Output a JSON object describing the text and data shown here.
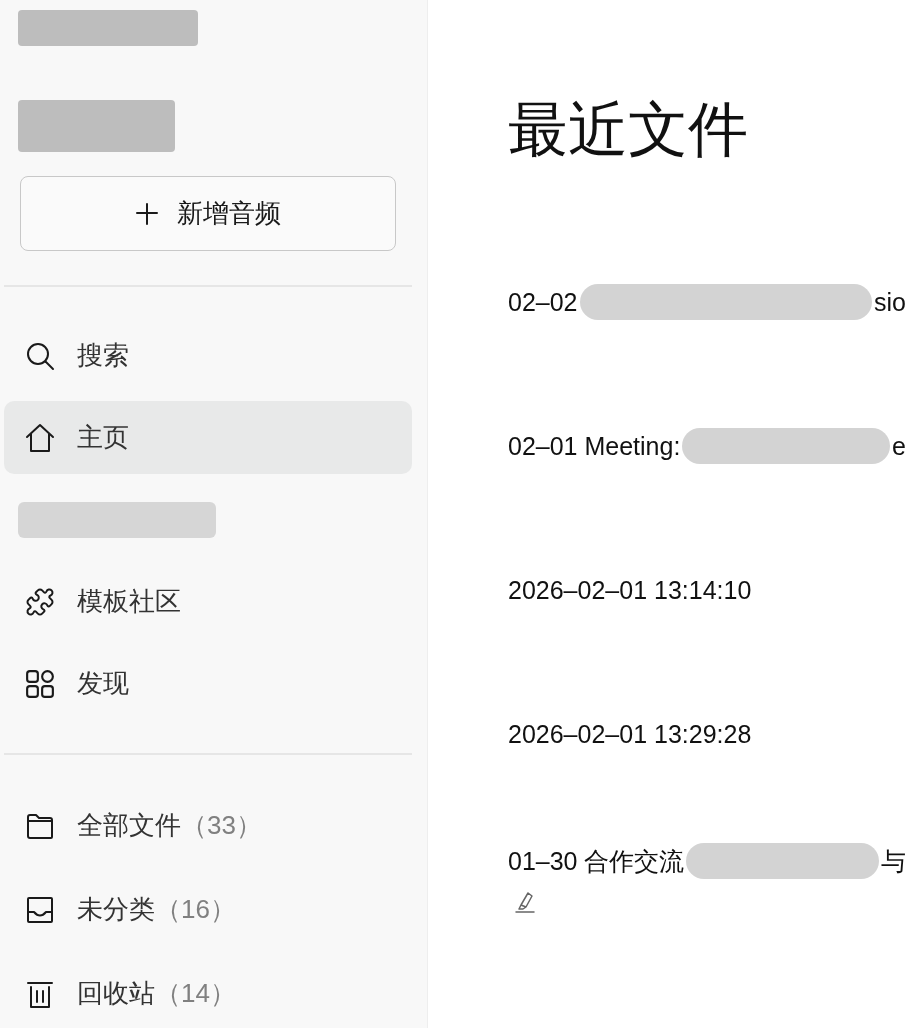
{
  "sidebar": {
    "header_lines": [
      {
        "kind": "redacted"
      },
      {
        "kind": "redacted"
      }
    ],
    "new_button": {
      "label": "新增音频"
    },
    "nav": [
      {
        "kind": "link",
        "label": "搜索",
        "selected": false
      },
      {
        "kind": "link",
        "label": "主页",
        "selected": true
      },
      {
        "kind": "redacted"
      },
      {
        "kind": "link",
        "label": "模板社区",
        "selected": false
      },
      {
        "kind": "link",
        "label": "发现",
        "selected": false
      }
    ],
    "folders": [
      {
        "label": "全部文件",
        "count": "（33）"
      },
      {
        "label": "未分类",
        "count": "（16）"
      },
      {
        "label": "回收站",
        "count": "（14）"
      }
    ]
  },
  "main": {
    "title": "最近文件",
    "files": [
      {
        "title": [
          {
            "kind": "text",
            "text": "02–02"
          },
          {
            "kind": "redacted"
          },
          {
            "kind": "text",
            "text": "sio"
          }
        ],
        "annotated": false
      },
      {
        "title": [
          {
            "kind": "text",
            "text": "02–01 Meeting:"
          },
          {
            "kind": "redacted"
          },
          {
            "kind": "text",
            "text": "e"
          }
        ],
        "annotated": false
      },
      {
        "title": [
          {
            "kind": "text",
            "text": "2026–02–01 13:14:10"
          }
        ],
        "annotated": false
      },
      {
        "title": [
          {
            "kind": "text",
            "text": "2026–02–01 13:29:28"
          }
        ],
        "annotated": false
      },
      {
        "title": [
          {
            "kind": "text",
            "text": "01–30 合作交流"
          },
          {
            "kind": "redacted"
          },
          {
            "kind": "text",
            "text": "与"
          }
        ],
        "annotated": true
      }
    ]
  }
}
